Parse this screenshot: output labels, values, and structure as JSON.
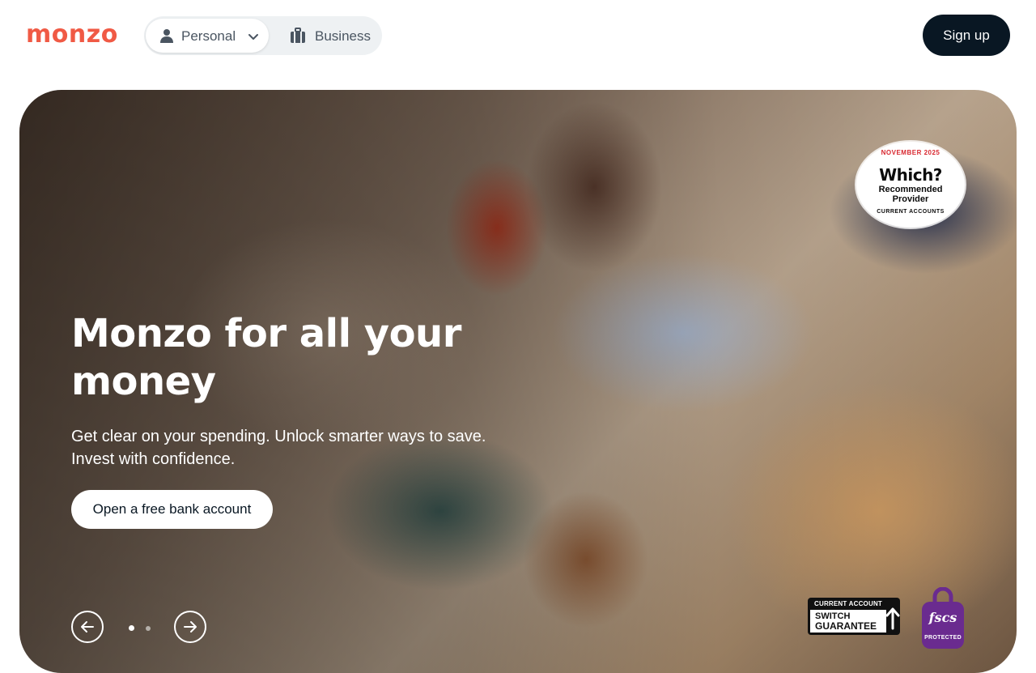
{
  "header": {
    "logo_text": "monzo",
    "segments": {
      "personal_label": "Personal",
      "business_label": "Business"
    },
    "signup_label": "Sign up"
  },
  "hero": {
    "title": "Monzo for all your money",
    "subtitle": "Get clear on your spending. Unlock smarter ways to save. Invest with confidence.",
    "cta_label": "Open a free bank account",
    "carousel": {
      "slide_count": 2,
      "active_index": 0
    }
  },
  "badges": {
    "which": {
      "date": "NOVEMBER 2025",
      "brand": "Which?",
      "line1": "Recommended",
      "line2": "Provider",
      "footer": "CURRENT ACCOUNTS"
    },
    "switch_guarantee": {
      "top": "CURRENT ACCOUNT",
      "line1": "SWITCH",
      "line2": "GUARANTEE"
    },
    "fscs": {
      "name": "fscs",
      "protected": "PROTECTED"
    }
  },
  "colors": {
    "brand": "#f05a45",
    "navy": "#091723",
    "fscs_purple": "#6a2b8f",
    "which_red": "#d8262e"
  },
  "icons": {
    "personal": "person-icon",
    "business": "briefcase-icon",
    "dropdown": "chevron-down-icon",
    "prev": "arrow-left-icon",
    "next": "arrow-right-icon"
  }
}
